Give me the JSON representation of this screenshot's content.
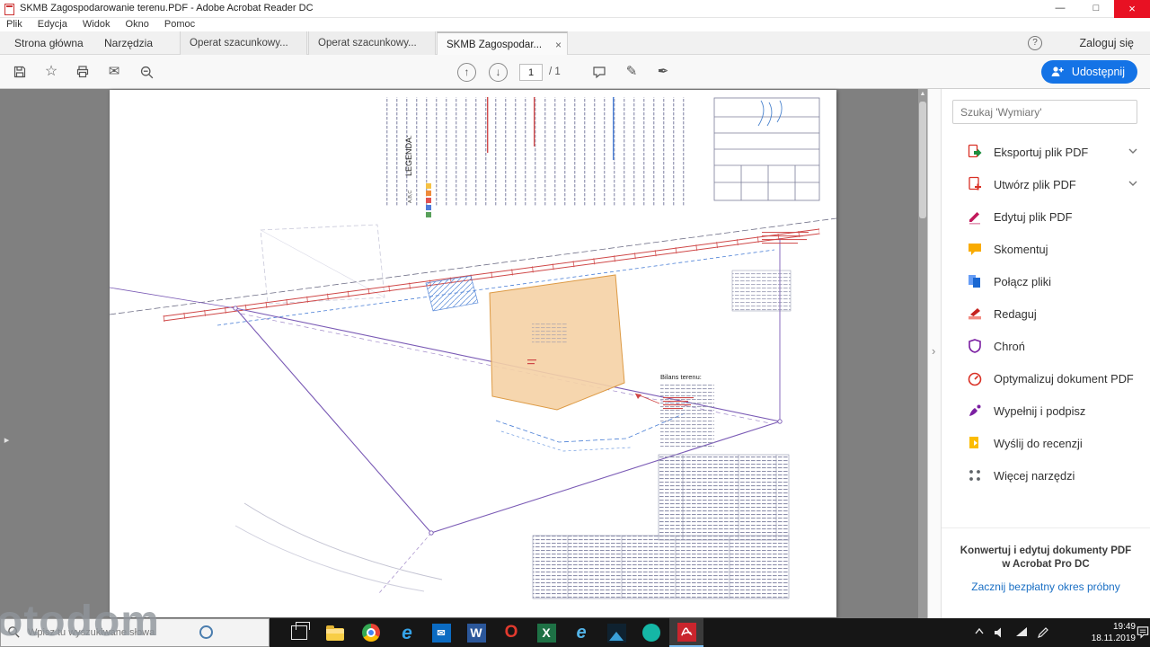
{
  "window": {
    "title": "SKMB Zagospodarowanie terenu.PDF - Adobe Acrobat Reader DC",
    "minimize": "—",
    "maximize": "□",
    "close": "×"
  },
  "menubar": {
    "items": [
      "Plik",
      "Edycja",
      "Widok",
      "Okno",
      "Pomoc"
    ]
  },
  "tabbar": {
    "home": "Strona główna",
    "tools": "Narzędzia",
    "doc_tabs": [
      {
        "label": "Operat szacunkowy..."
      },
      {
        "label": "Operat szacunkowy..."
      },
      {
        "label": "SKMB Zagospodar...",
        "close": "×"
      }
    ],
    "help": "?",
    "login": "Zaloguj się"
  },
  "toolbar": {
    "page_current": "1",
    "page_count": "/ 1",
    "share_label": "Udostępnij"
  },
  "drawing": {
    "legend_title": "LEGENDA:",
    "legend_abc": "A,B,C",
    "bilans_title": "Bilans terenu:"
  },
  "panel": {
    "search_placeholder": "Szukaj 'Wymiary'",
    "tools": [
      {
        "label": "Eksportuj plik PDF"
      },
      {
        "label": "Utwórz plik PDF"
      },
      {
        "label": "Edytuj plik PDF"
      },
      {
        "label": "Skomentuj"
      },
      {
        "label": "Połącz pliki"
      },
      {
        "label": "Redaguj"
      },
      {
        "label": "Chroń"
      },
      {
        "label": "Optymalizuj dokument PDF"
      },
      {
        "label": "Wypełnij i podpisz"
      },
      {
        "label": "Wyślij do recenzji"
      },
      {
        "label": "Więcej narzędzi"
      }
    ],
    "promo_line1": "Konwertuj i edytuj dokumenty PDF",
    "promo_line2": "w Acrobat Pro DC",
    "promo_link": "Zacznij bezpłatny okres próbny"
  },
  "taskbar": {
    "search_placeholder": "Wpisz tu wyszukiwane słowa",
    "apps": [
      {
        "name": "task-view"
      },
      {
        "name": "file-explorer"
      },
      {
        "name": "chrome"
      },
      {
        "name": "edge",
        "glyph": "e"
      },
      {
        "name": "mail",
        "glyph": "✉"
      },
      {
        "name": "word",
        "glyph": "W"
      },
      {
        "name": "opera",
        "glyph": "O"
      },
      {
        "name": "excel",
        "glyph": "X"
      },
      {
        "name": "internet-explorer",
        "glyph": "e"
      },
      {
        "name": "photos"
      },
      {
        "name": "groove"
      },
      {
        "name": "acrobat-reader"
      }
    ],
    "clock": {
      "time": "19:49",
      "date": "18.11.2019"
    }
  },
  "watermark": {
    "text": "otodom"
  }
}
